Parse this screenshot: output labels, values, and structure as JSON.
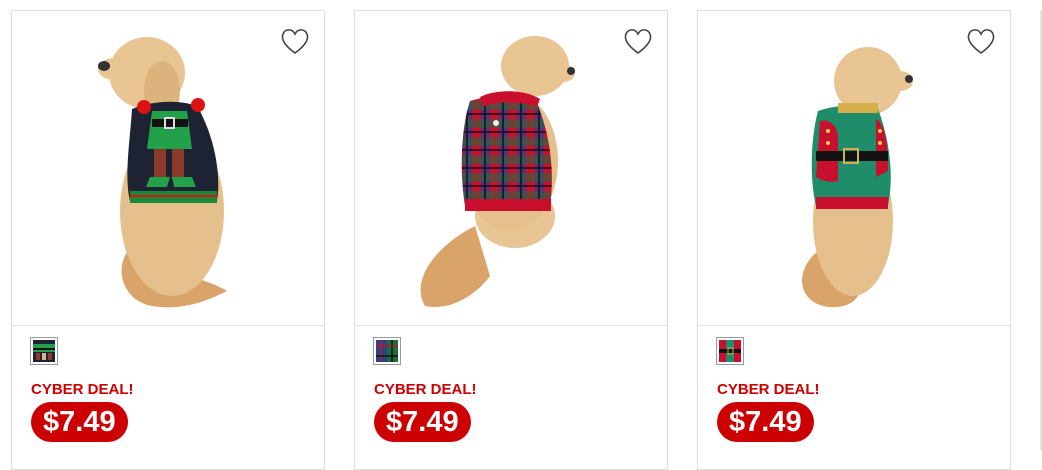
{
  "products": [
    {
      "image_alt": "Dog wearing elf sweater",
      "favorite_icon": "heart-outline-icon",
      "swatch": "elf-pattern-swatch",
      "deal_label": "CYBER DEAL!",
      "price": "$7.49"
    },
    {
      "image_alt": "Dog wearing plaid sweater",
      "favorite_icon": "heart-outline-icon",
      "swatch": "plaid-pattern-swatch",
      "deal_label": "CYBER DEAL!",
      "price": "$7.49"
    },
    {
      "image_alt": "Dog wearing Santa-style green sweater",
      "favorite_icon": "heart-outline-icon",
      "swatch": "green-santa-swatch",
      "deal_label": "CYBER DEAL!",
      "price": "$7.49"
    }
  ],
  "colors": {
    "deal_red": "#cc0000",
    "border": "#dedede",
    "swatch_border": "#9a9a9a"
  }
}
